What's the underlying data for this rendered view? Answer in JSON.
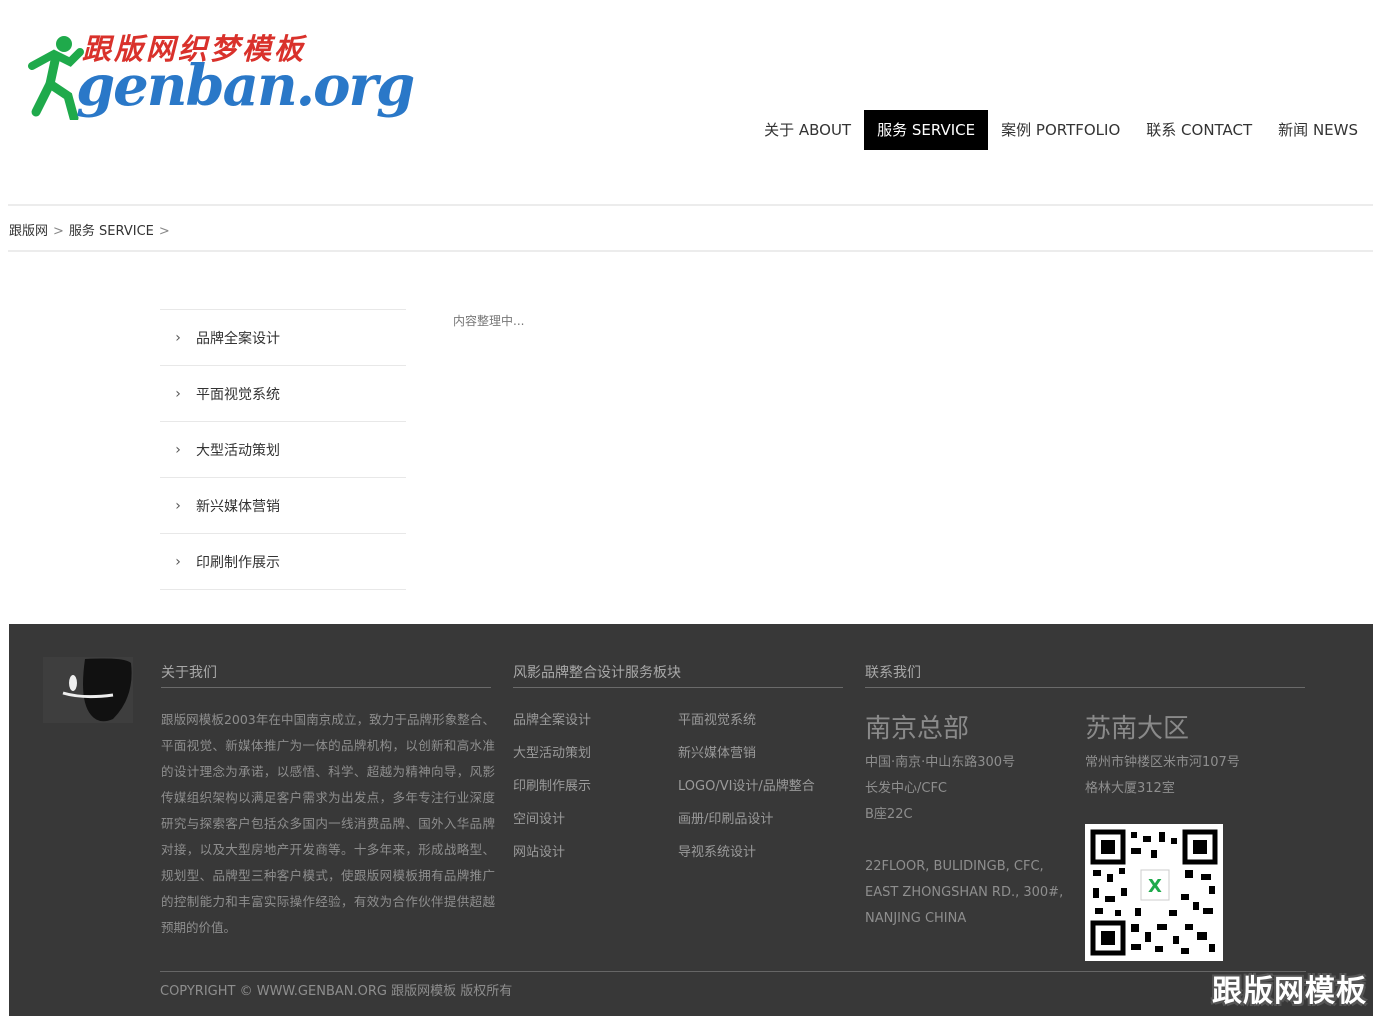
{
  "brand": {
    "logo_cn": "跟版网织梦模板",
    "logo_en": "genban.org",
    "colors": {
      "red": "#d9312b",
      "blue": "#2a78c8",
      "green": "#1faa4b"
    }
  },
  "nav": [
    {
      "label": "关于 ABOUT",
      "active": false
    },
    {
      "label": "服务 SERVICE",
      "active": true
    },
    {
      "label": "案例 PORTFOLIO",
      "active": false
    },
    {
      "label": "联系 CONTACT",
      "active": false
    },
    {
      "label": "新闻 NEWS",
      "active": false
    }
  ],
  "breadcrumb": {
    "home": "跟版网",
    "sep": ">",
    "current": "服务 SERVICE"
  },
  "sidebar": {
    "items": [
      {
        "label": "品牌全案设计"
      },
      {
        "label": "平面视觉系统"
      },
      {
        "label": "大型活动策划"
      },
      {
        "label": "新兴媒体营销"
      },
      {
        "label": "印刷制作展示"
      }
    ]
  },
  "main": {
    "note": "内容整理中..."
  },
  "footer": {
    "about": {
      "title": "关于我们",
      "text": "跟版网模板2003年在中国南京成立，致力于品牌形象整合、平面视觉、新媒体推广为一体的品牌机构，以创新和高水准的设计理念为承诺，以感悟、科学、超越为精神向导，风影传媒组织架构以满足客户需求为出发点，多年专注行业深度研究与探索客户包括众多国内一线消费品牌、国外入华品牌对接，以及大型房地产开发商等。十多年来，形成战略型、规划型、品牌型三种客户模式，使跟版网模板拥有品牌推广的控制能力和丰富实际操作经验，有效为合作伙伴提供超越预期的价值。"
    },
    "services": {
      "title": "风影品牌整合设计服务板块",
      "left": [
        "品牌全案设计",
        "大型活动策划",
        "印刷制作展示",
        "空间设计",
        "网站设计"
      ],
      "right": [
        "平面视觉系统",
        "新兴媒体营销",
        "LOGO/VI设计/品牌整合",
        "画册/印刷品设计",
        "导视系统设计"
      ]
    },
    "contact": {
      "title": "联系我们",
      "nanjing": {
        "city": "南京总部",
        "lines": [
          "中国·南京·中山东路300号",
          "长发中心/CFC",
          "B座22C"
        ],
        "en_lines": [
          "22FLOOR, BULIDINGB, CFC,",
          "EAST ZHONGSHAN RD., 300#,",
          "NANJING CHINA"
        ]
      },
      "sunan": {
        "city": "苏南大区",
        "lines": [
          "常州市钟楼区米市河107号",
          "格林大厦312室"
        ]
      }
    },
    "copyright": "COPYRIGHT © WWW.GENBAN.ORG 跟版网模板 版权所有"
  },
  "watermark": "跟版网模板"
}
